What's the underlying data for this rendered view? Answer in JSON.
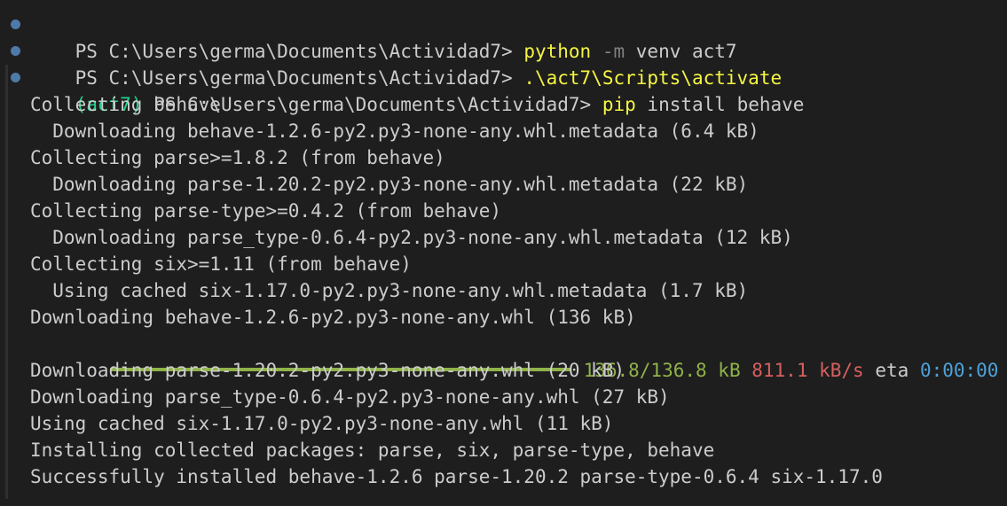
{
  "terminal": {
    "prompts": [
      {
        "venv": "",
        "path": "PS C:\\Users\\germa\\Documents\\Actividad7> ",
        "command": "python",
        "flag": "-m",
        "args": "venv act7"
      },
      {
        "venv": "",
        "path": "PS C:\\Users\\germa\\Documents\\Actividad7> ",
        "command": ".\\act7\\Scripts\\activate",
        "flag": "",
        "args": ""
      },
      {
        "venv": "(act7) ",
        "path": "PS C:\\Users\\germa\\Documents\\Actividad7> ",
        "command": "pip",
        "flag": "",
        "args": "install behave"
      }
    ],
    "output_before_progress": [
      "Collecting behave",
      "  Downloading behave-1.2.6-py2.py3-none-any.whl.metadata (6.4 kB)",
      "Collecting parse>=1.8.2 (from behave)",
      "  Downloading parse-1.20.2-py2.py3-none-any.whl.metadata (22 kB)",
      "Collecting parse-type>=0.4.2 (from behave)",
      "  Downloading parse_type-0.6.4-py2.py3-none-any.whl.metadata (12 kB)",
      "Collecting six>=1.11 (from behave)",
      "  Using cached six-1.17.0-py2.py3-none-any.whl.metadata (1.7 kB)",
      "Downloading behave-1.2.6-py2.py3-none-any.whl (136 kB)"
    ],
    "progress": {
      "fraction": 1.0,
      "size": "136.8/136.8 kB",
      "speed": "811.1 kB/s",
      "eta_label": "eta",
      "eta": "0:00:00"
    },
    "output_after_progress": [
      "Downloading parse-1.20.2-py2.py3-none-any.whl (20 kB)",
      "Downloading parse_type-0.6.4-py2.py3-none-any.whl (27 kB)",
      "Using cached six-1.17.0-py2.py3-none-any.whl (11 kB)",
      "Installing collected packages: parse, six, parse-type, behave",
      "Successfully installed behave-1.2.6 parse-1.20.2 parse-type-0.6.4 six-1.17.0"
    ]
  },
  "colors": {
    "background": "#1e1e1e",
    "foreground": "#cccccc",
    "command": "#f5f543",
    "venv": "#23d18b",
    "progress_bar": "#8fb24a",
    "speed": "#d75f5f",
    "eta": "#4ea1d8",
    "decoration": "#4d7aa8"
  }
}
